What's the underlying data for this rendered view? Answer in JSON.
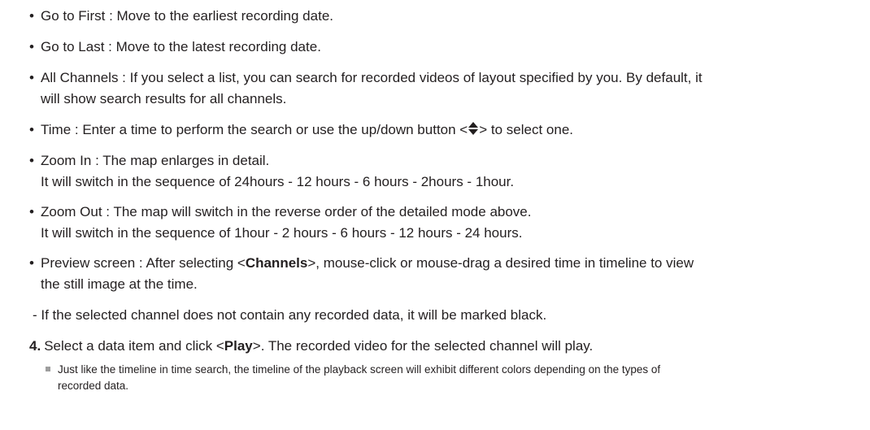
{
  "items": [
    {
      "text": "Go to First : Move to the earliest recording date."
    },
    {
      "text": "Go to Last : Move to the latest recording date."
    },
    {
      "line1": "All Channels : If you select a list, you can search for recorded videos of layout specified by you. By default, it",
      "line2": "will show search results for all channels."
    },
    {
      "pre": "Time : Enter a time to perform the search or use the up/down button <",
      "post": "> to select one.",
      "icon": "up-down-arrows-icon"
    },
    {
      "line1": "Zoom In : The map enlarges in detail.",
      "line2": "It will switch in the sequence of 24hours - 12 hours - 6 hours - 2hours - 1hour."
    },
    {
      "line1": "Zoom Out : The map will switch in the reverse order of the detailed mode above.",
      "line2": "It will switch in the sequence of 1hour - 2 hours - 6 hours - 12 hours - 24 hours."
    },
    {
      "pre": "Preview screen : After selecting <",
      "bold": "Channels",
      "post": ">, mouse-click or mouse-drag a desired time in timeline to view",
      "line2": "the still image at the time."
    }
  ],
  "sub_note": "- If the selected channel does not contain any recorded data, it will be marked black.",
  "step": {
    "number": "4.",
    "pre": "Select a data item and click <",
    "bold": "Play",
    "post": ">. The recorded video for the selected channel will play."
  },
  "note": {
    "line1": "Just like the timeline in time search, the timeline of the playback screen will exhibit different colors depending on the types of",
    "line2": "recorded data."
  }
}
